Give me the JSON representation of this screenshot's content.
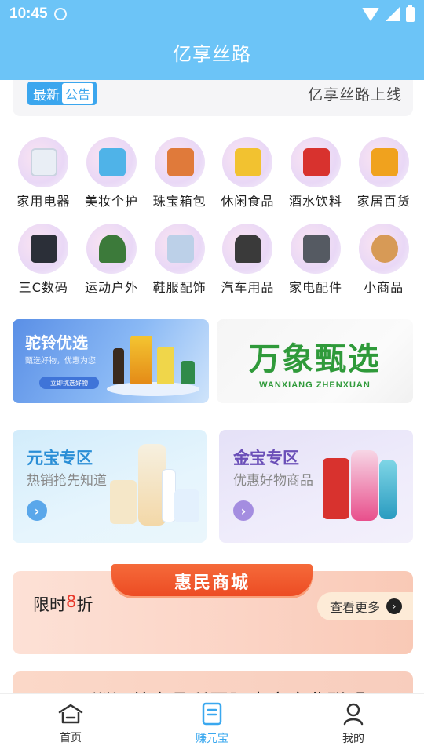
{
  "status_bar": {
    "time": "10:45"
  },
  "header": {
    "title": "亿享丝路"
  },
  "notice": {
    "tag_prefix": "最新",
    "tag_label": "公告",
    "text": "亿享丝路上线"
  },
  "categories": [
    {
      "label": "家用电器",
      "icon": "appliance-icon",
      "color": "#e9eef5"
    },
    {
      "label": "美妆个护",
      "icon": "cosmetics-icon",
      "color": "#4fb3e8"
    },
    {
      "label": "珠宝箱包",
      "icon": "handbag-icon",
      "color": "#e07a3a"
    },
    {
      "label": "休闲食品",
      "icon": "snacks-icon",
      "color": "#f2c230"
    },
    {
      "label": "酒水饮料",
      "icon": "drinks-icon",
      "color": "#d8322e"
    },
    {
      "label": "家居百货",
      "icon": "oil-icon",
      "color": "#f0a21e"
    },
    {
      "label": "三C数码",
      "icon": "laptop-icon",
      "color": "#2b2f38"
    },
    {
      "label": "运动户外",
      "icon": "tent-icon",
      "color": "#3c7a3a"
    },
    {
      "label": "鞋服配饰",
      "icon": "clothes-icon",
      "color": "#bcd0e8"
    },
    {
      "label": "汽车用品",
      "icon": "car-seat-icon",
      "color": "#3a3a3a"
    },
    {
      "label": "家电配件",
      "icon": "washer-icon",
      "color": "#555a62"
    },
    {
      "label": "小商品",
      "icon": "vase-icon",
      "color": "#d79a56"
    }
  ],
  "banner_left": {
    "title": "驼铃优选",
    "subtitle": "甄选好物，优惠为您",
    "button": "立即挑选好物"
  },
  "banner_right": {
    "title": "万象甄选",
    "subtitle": "WANXIANG ZHENXUAN"
  },
  "zones": [
    {
      "title": "元宝专区",
      "subtitle": "热销抢先知道"
    },
    {
      "title": "金宝专区",
      "subtitle": "优惠好物商品"
    }
  ],
  "huimin": {
    "banner": "惠民商城",
    "promo_prefix": "限时",
    "promo_number": "8",
    "promo_suffix": "折",
    "more": "查看更多"
  },
  "partial_card": {
    "text": "亚洲汇善产品所国际十方企业联盟"
  },
  "bottom_nav": [
    {
      "label": "首页",
      "icon": "home-icon"
    },
    {
      "label": "赚元宝",
      "icon": "document-icon"
    },
    {
      "label": "我的",
      "icon": "user-icon"
    }
  ],
  "colors": {
    "header": "#6cc4f7",
    "accent": "#3aa8ef",
    "promo_red": "#e8382a"
  }
}
